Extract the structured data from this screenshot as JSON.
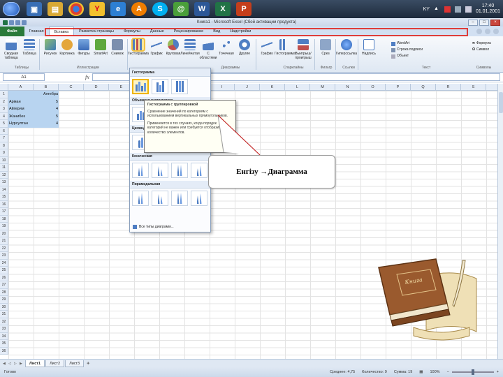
{
  "taskbar": {
    "apps": [
      "windows-explorer",
      "file-manager",
      "chrome",
      "yandex",
      "internet-explorer",
      "avast",
      "skype",
      "mail",
      "word",
      "excel",
      "powerpoint"
    ],
    "tray": {
      "lang": "KY",
      "time": "17:40",
      "date": "01.01.2001"
    }
  },
  "window": {
    "title": "Книга1 - Microsoft Excel (Сбой активации продукта)"
  },
  "ribbon_tabs": [
    "Файл",
    "Главная",
    "Вставка",
    "Разметка страницы",
    "Формулы",
    "Данные",
    "Рецензирование",
    "Вид",
    "Надстройки"
  ],
  "ribbon": {
    "buttons": [
      "Сводная таблица",
      "Таблица",
      "Рисунок",
      "Картинка",
      "Фигуры",
      "SmartArt",
      "Снимок",
      "Гистограмма",
      "График",
      "Круговая",
      "Линейчатая",
      "С областями",
      "Точечная",
      "Другие",
      "График",
      "Гистограмма",
      "Выигрыш/проигрыш",
      "Срез",
      "Гиперссылка",
      "Надпись"
    ],
    "groups": [
      "Таблицы",
      "Иллюстрации",
      "Диаграммы",
      "Спарклайны",
      "Фильтр",
      "Ссылки",
      "Текст",
      "Символы"
    ],
    "text_list": [
      "WordArt",
      "Строка подписи",
      "Объект"
    ],
    "symbols_list": [
      "Формула",
      "Символ"
    ]
  },
  "formula_bar": {
    "name_box": "A1",
    "fx": "fx",
    "value": ""
  },
  "sheet": {
    "columns": [
      "A",
      "B",
      "C",
      "D",
      "E",
      "F",
      "G",
      "H",
      "I",
      "J",
      "K",
      "L",
      "M",
      "N",
      "O",
      "P",
      "Q",
      "R",
      "S",
      "T"
    ],
    "rows": [
      "1",
      "2",
      "3",
      "4",
      "5",
      "6",
      "7",
      "8",
      "9",
      "10",
      "11",
      "12",
      "13",
      "14",
      "15",
      "16",
      "17",
      "18",
      "19",
      "20",
      "21",
      "22",
      "23",
      "24",
      "25",
      "26",
      "27",
      "28",
      "29",
      "30",
      "31",
      "32",
      "33",
      "34",
      "35",
      "36"
    ],
    "header_cell": "Алгебра",
    "names": [
      "Арман",
      "Айгерим",
      "Жанибек",
      "Нурсултан"
    ],
    "values": [
      "5",
      "4",
      "5",
      "4"
    ]
  },
  "gallery": {
    "sections": [
      "Гистограмма",
      "Объемная гистограмма",
      "Цилиндрическая",
      "Коническая",
      "Пирамидальная"
    ],
    "all_types": "Все типы диаграмм..."
  },
  "tooltip": {
    "title": "Гистограмма с группировкой",
    "line1": "Сравнение значений по категориям с использованием вертикальных прямоугольников.",
    "line2": "Применяется в тех случаях, когда порядок категорий не важен или требуется отобразить количество элементов."
  },
  "callout": {
    "text": "Енгізу →Диаграмма"
  },
  "sheet_tabs": [
    "Лист1",
    "Лист2",
    "Лист3"
  ],
  "status": {
    "ready": "Готово",
    "average": "Среднее: 4,75",
    "count": "Количество: 9",
    "sum": "Сумма: 19",
    "zoom": "100%"
  },
  "colors": {
    "excel_green": "#2a7a3a",
    "highlight_red": "#e0201a",
    "selection_blue": "#b8d4f0"
  }
}
